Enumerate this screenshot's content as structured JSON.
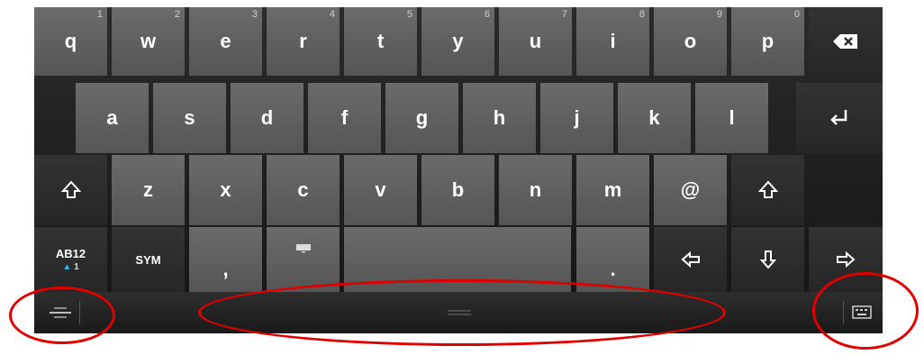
{
  "row1": [
    {
      "label": "q",
      "hint": "1"
    },
    {
      "label": "w",
      "hint": "2"
    },
    {
      "label": "e",
      "hint": "3"
    },
    {
      "label": "r",
      "hint": "4"
    },
    {
      "label": "t",
      "hint": "5"
    },
    {
      "label": "y",
      "hint": "6"
    },
    {
      "label": "u",
      "hint": "7"
    },
    {
      "label": "i",
      "hint": "8"
    },
    {
      "label": "o",
      "hint": "9"
    },
    {
      "label": "p",
      "hint": "0"
    }
  ],
  "row2": [
    {
      "label": "a"
    },
    {
      "label": "s"
    },
    {
      "label": "d"
    },
    {
      "label": "f"
    },
    {
      "label": "g"
    },
    {
      "label": "h"
    },
    {
      "label": "j"
    },
    {
      "label": "k"
    },
    {
      "label": "l"
    }
  ],
  "row3": [
    {
      "label": "z"
    },
    {
      "label": "x"
    },
    {
      "label": "c"
    },
    {
      "label": "v"
    },
    {
      "label": "b"
    },
    {
      "label": "n"
    },
    {
      "label": "m"
    },
    {
      "label": "@"
    }
  ],
  "row4": {
    "mode_label": "AB12",
    "mode_sub": "1",
    "sym_label": "SYM",
    "comma_label": ",",
    "period_label": "."
  },
  "icons": {
    "backspace": "backspace-icon",
    "enter": "enter-icon",
    "shift": "shift-icon",
    "keyboard": "keyboard-icon",
    "arrows": [
      "arrow-left-icon",
      "arrow-down-icon",
      "arrow-right-icon"
    ]
  },
  "annotation_color": "#e00000"
}
